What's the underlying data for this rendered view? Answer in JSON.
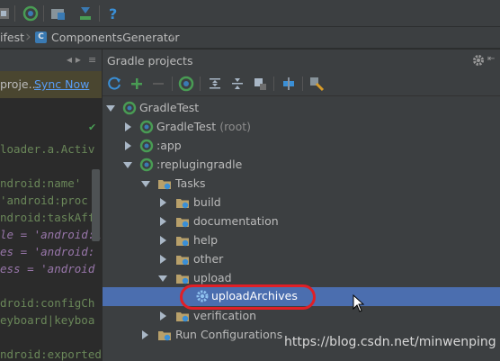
{
  "breadcrumb": {
    "items": [
      "ifest",
      "ComponentsGenerator"
    ]
  },
  "editor": {
    "notice_text": "proje...",
    "sync_link": "Sync Now",
    "lines": [
      "loader.a.Activ",
      "ndroid:name'",
      "'android:proc",
      "ndroid:taskAff",
      "le = 'android:l",
      "es = 'android:",
      "ess = 'android",
      "droid:configCh",
      "eyboard|keyboa",
      "ndroid:exported"
    ]
  },
  "gradle_panel": {
    "title": "Gradle projects",
    "tree": {
      "root": "GradleTest",
      "children": [
        {
          "label": "GradleTest",
          "suffix": "(root)"
        },
        {
          "label": ":app"
        },
        {
          "label": ":replugingradle"
        }
      ],
      "tasks": "Tasks",
      "task_groups": [
        "build",
        "documentation",
        "help",
        "other",
        "upload"
      ],
      "selected_task": "uploadArchives",
      "after": [
        "verification"
      ],
      "run_configurations": "Run Configurations"
    }
  },
  "watermark": "https://blog.csdn.net/minwenping",
  "colors": {
    "background": "#2b2b2b",
    "panel": "#3c3f41",
    "selection": "#4b6eaf",
    "link": "#589df6",
    "highlight": "#e01f26"
  }
}
